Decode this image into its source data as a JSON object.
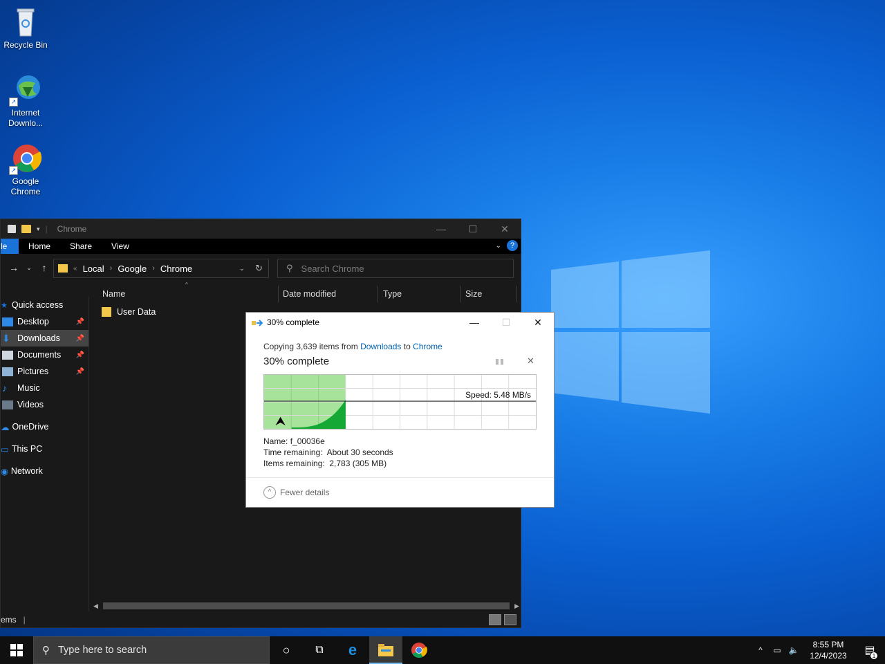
{
  "desktop": {
    "icons": [
      {
        "label": "Recycle Bin"
      },
      {
        "label": "Internet Downlo..."
      },
      {
        "label": "Google Chrome"
      }
    ]
  },
  "explorer": {
    "title": "Chrome",
    "ribbon": {
      "file": "le",
      "home": "Home",
      "share": "Share",
      "view": "View"
    },
    "breadcrumb": [
      "Local",
      "Google",
      "Chrome"
    ],
    "search_placeholder": "Search Chrome",
    "columns": {
      "name": "Name",
      "date": "Date modified",
      "type": "Type",
      "size": "Size"
    },
    "files": [
      {
        "name": "User Data"
      }
    ],
    "nav": {
      "quick_access": "Quick access",
      "desktop": "Desktop",
      "downloads": "Downloads",
      "documents": "Documents",
      "pictures": "Pictures",
      "music": "Music",
      "videos": "Videos",
      "onedrive": "OneDrive",
      "this_pc": "This PC",
      "network": "Network"
    },
    "status": "ems"
  },
  "copy_dialog": {
    "title": "30% complete",
    "copying_prefix": "Copying 3,639 items from ",
    "source": "Downloads",
    "to": " to ",
    "dest": "Chrome",
    "percent_label": "30% complete",
    "progress_fraction": 0.3,
    "speed": "Speed: 5.48 MB/s",
    "name_label": "Name:",
    "name_value": "f_00036e",
    "time_label": "Time remaining:",
    "time_value": "About 30 seconds",
    "items_label": "Items remaining:",
    "items_value": "2,783 (305 MB)",
    "fewer_details": "Fewer details"
  },
  "taskbar": {
    "search_placeholder": "Type here to search",
    "time": "8:55 PM",
    "date": "12/4/2023",
    "notifications": "1"
  },
  "colors": {
    "accent": "#1a73d8",
    "progress_fill": "#a7e39a",
    "speed_graph": "#15a835",
    "link": "#0063b1"
  }
}
